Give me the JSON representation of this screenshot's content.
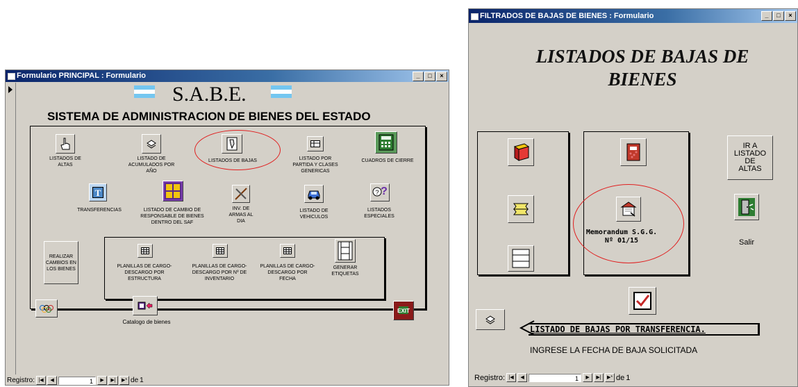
{
  "left_window": {
    "title": "Formulario PRINCIPAL : Formulario",
    "heading": "S.A.B.E.",
    "subheading": "SISTEMA DE ADMINISTRACION DE BIENES DEL ESTADO",
    "buttons": {
      "listados_altas": "LISTADOS DE ALTAS",
      "listado_acumulados": "LISTADO DE ACUMULADOS POR AÑO",
      "listados_bajas": "LISTADOS DE BAJAS",
      "listado_partida": "LISTADO POR PARTIDA Y CLASES GENERICAS",
      "cuadros_cierre": "CUADROS DE CIERRE",
      "transferencias": "TRANSFERENCIAS",
      "cambio_responsable": "LISTADO DE CAMBIO DE RESPONSABLE DE BIENES DENTRO DEL SAF",
      "inv_armas": "INV. DE ARMAS AL DIA",
      "listado_vehiculos": "LISTADO DE VEHICULOS",
      "listados_especiales": "LISTADOS ESPECIALES",
      "realizar_cambios": "REALIZAR CAMBIOS EN LOS BIENES",
      "planillas_estructura": "PLANILLAS DE CARGO-DESCARGO POR ESTRUCTURA",
      "planillas_inventario": "PLANILLAS DE CARGO- DESCARGO POR Nº DE INVENTARIO",
      "planillas_fecha": "PLANILLAS DE CARGO-DESCARGO POR FECHA",
      "generar_etiquetas": "GENERAR ETIQUETAS",
      "catalogo": "Catalogo de bienes",
      "exit": "EXIT"
    },
    "record_nav": {
      "label": "Registro:",
      "current": "1",
      "of_label": "de",
      "total": "1"
    }
  },
  "right_window": {
    "title": "FILTRADOS DE BAJAS DE BIENES : Formulario",
    "heading": "LISTADOS DE BAJAS DE BIENES",
    "ir_listado_altas": "IR A LISTADO DE ALTAS",
    "memorandum": "Memorandum S.G.G. Nº 01/15",
    "salir": "Salir",
    "transferencia_label": "LISTADO DE BAJAS POR TRANSFERENCIA.",
    "ingrese_fecha": "INGRESE LA FECHA DE BAJA SOLICITADA",
    "record_nav": {
      "label": "Registro:",
      "current": "1",
      "of_label": "de",
      "total": "1"
    }
  },
  "titlebar_buttons": {
    "minimize": "_",
    "maximize": "□",
    "close": "×"
  }
}
